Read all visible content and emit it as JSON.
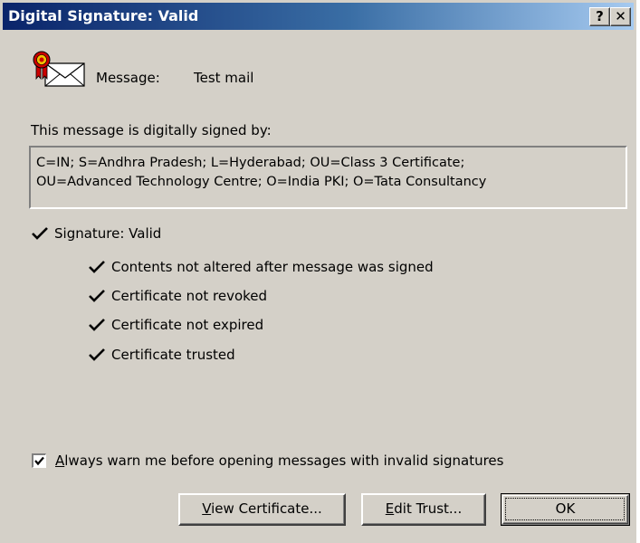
{
  "window": {
    "title": "Digital Signature: Valid",
    "help_glyph": "?",
    "close_glyph": "✕"
  },
  "message": {
    "icon": "signed-envelope-icon",
    "label": "Message:",
    "subject": "Test mail"
  },
  "signed_by": {
    "label": "This message is digitally signed by:",
    "lines": [
      "C=IN; S=Andhra Pradesh; L=Hyderabad; OU=Class 3 Certificate;",
      "OU=Advanced Technology Centre; O=India PKI; O=Tata Consultancy"
    ]
  },
  "signature": {
    "status": "Signature: Valid",
    "checks": [
      "Contents not altered after message was signed",
      "Certificate not revoked",
      "Certificate not expired",
      "Certificate trusted"
    ]
  },
  "warn_option": {
    "checked": true,
    "label_accel": "A",
    "label_rest": "lways warn me before opening messages with invalid signatures"
  },
  "buttons": {
    "view_accel": "V",
    "view_rest": "iew Certificate...",
    "edit_accel": "E",
    "edit_rest": "dit Trust...",
    "ok": "OK"
  },
  "colors": {
    "titlebar_start": "#0a246a",
    "titlebar_end": "#a6caf0",
    "dialog_face": "#d4d0c8",
    "ribbon_red": "#cc0000"
  }
}
